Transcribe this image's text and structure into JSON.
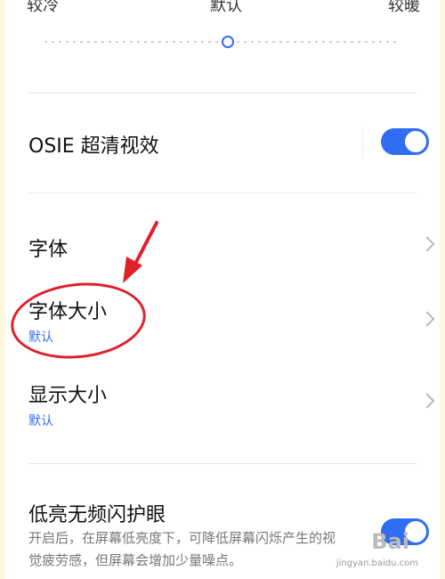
{
  "color_temperature": {
    "cold_label": "较冷",
    "default_label": "默认",
    "warm_label": "较暖",
    "level": 0.5
  },
  "osie": {
    "label": "OSIE 超清视效",
    "enabled": true
  },
  "font": {
    "label": "字体"
  },
  "font_size": {
    "label": "字体大小",
    "value": "默认"
  },
  "display_size": {
    "label": "显示大小",
    "value": "默认"
  },
  "flicker_free": {
    "label": "低亮无频闪护眼",
    "description": "开启后，在屏幕低亮度下，可降低屏幕闪烁产生的视觉疲劳感，但屏幕会增加少量噪点。",
    "enabled": true
  },
  "watermark": {
    "logo": "Bai",
    "text": "jingyan.baidu.com"
  },
  "colors": {
    "accent": "#2f6df2",
    "annotation": "#e0202a"
  }
}
